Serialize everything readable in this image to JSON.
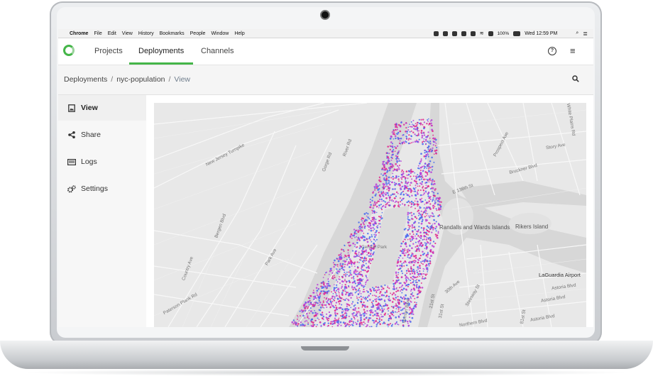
{
  "menubar": {
    "app": "Chrome",
    "items": [
      "File",
      "Edit",
      "View",
      "History",
      "Bookmarks",
      "People",
      "Window",
      "Help"
    ],
    "battery": "100%",
    "clock": "Wed 12:59 PM"
  },
  "nav": {
    "tabs": [
      {
        "label": "Projects"
      },
      {
        "label": "Deployments",
        "active": true
      },
      {
        "label": "Channels"
      }
    ],
    "accent_color": "#44b548"
  },
  "breadcrumb": {
    "root": "Deployments",
    "item": "nyc-population",
    "current": "View",
    "separator": "/"
  },
  "sidebar": {
    "items": [
      {
        "label": "View",
        "icon": "image-file-icon",
        "active": true
      },
      {
        "label": "Share",
        "icon": "share-icon"
      },
      {
        "label": "Logs",
        "icon": "logs-icon"
      },
      {
        "label": "Settings",
        "icon": "gears-icon"
      }
    ]
  },
  "map": {
    "labels": [
      "New Jersey Turnpike",
      "Gorge Rd",
      "River Rd",
      "Park Ave",
      "Bergen Blvd",
      "E 138th St",
      "Prospect Ave",
      "Story Ave",
      "White Plains Rd",
      "Randalls and Wards Islands",
      "Rikers Island",
      "LaGuardia Airport",
      "Astoria Blvd",
      "Northern Blvd",
      "30th Ave",
      "Steinway St",
      "31st St",
      "21st St",
      "Vernon Blvd",
      "Central Park",
      "Bruckner Blvd",
      "Astoria Blvd",
      "81st St",
      "Country Ave",
      "Paterson Plank Rd",
      "Astoria Blvd"
    ],
    "dot_colors": [
      "#e0218a",
      "#4466ee",
      "#b83dd8"
    ]
  }
}
